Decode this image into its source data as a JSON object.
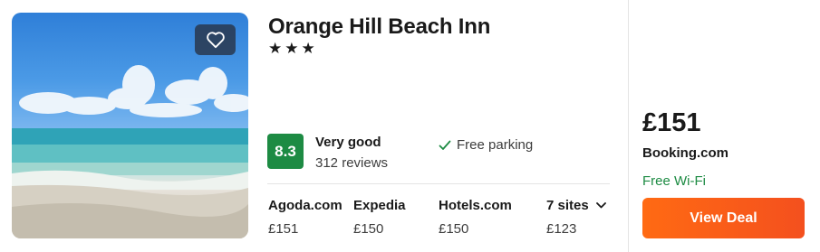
{
  "listing": {
    "name": "Orange Hill Beach Inn",
    "stars_text": "★★★",
    "rating_score": "8.3",
    "rating_label": "Very good",
    "review_count": "312 reviews",
    "amenity": "Free parking",
    "amenity_icon": "check-icon",
    "favorite_icon": "heart-icon",
    "badge_color": "#1d8b43"
  },
  "sites": [
    {
      "name": "Agoda.com",
      "price": "£151"
    },
    {
      "name": "Expedia",
      "price": "£150"
    },
    {
      "name": "Hotels.com",
      "price": "£150"
    },
    {
      "name": "7 sites",
      "price": "£123",
      "icon": "chevron-down-icon"
    }
  ],
  "offer": {
    "price": "£151",
    "provider": "Booking.com",
    "perk": "Free Wi-Fi",
    "button_label": "View Deal",
    "button_color": "#f4501e",
    "perk_color": "#1d8b43"
  }
}
